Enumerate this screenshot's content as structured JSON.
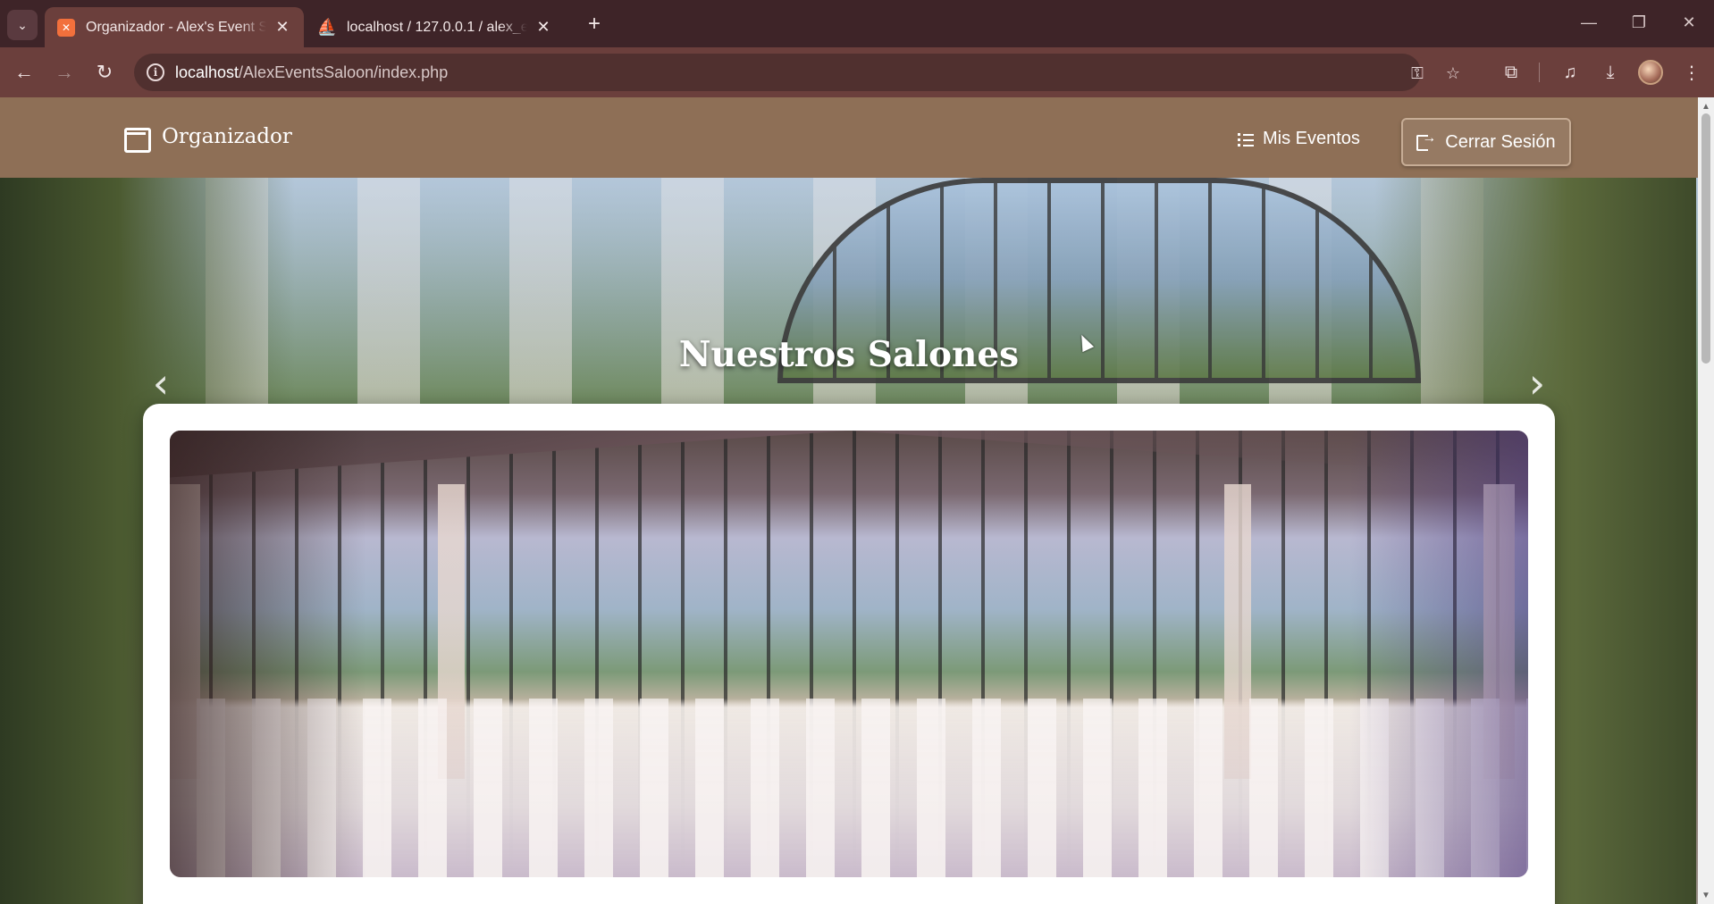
{
  "browser": {
    "tabs": [
      {
        "title": "Organizador - Alex's Event Salo",
        "favicon": "xampp-icon",
        "active": true
      },
      {
        "title": "localhost / 127.0.0.1 / alex_even",
        "favicon": "phpmyadmin-icon",
        "active": false
      }
    ],
    "new_tab_symbol": "+",
    "url": {
      "host": "localhost",
      "path": "/AlexEventsSaloon/index.php"
    },
    "window_controls": {
      "minimize": "—",
      "restore": "❐",
      "close": "✕"
    }
  },
  "navbar": {
    "brand": "Organizador",
    "brand_icon": "calendar-icon",
    "links": [
      {
        "label": "Mis Eventos",
        "icon": "list-icon"
      }
    ],
    "logout_label": "Cerrar Sesión",
    "logout_icon": "logout-icon",
    "background_color": "#8e6f56"
  },
  "main": {
    "section_title": "Nuestros Salones",
    "carousel": {
      "prev_symbol": "‹",
      "next_symbol": "›"
    }
  }
}
